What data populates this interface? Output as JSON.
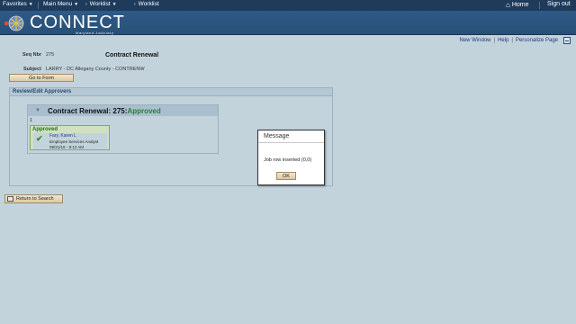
{
  "topbar": {
    "favorites": "Favorites",
    "main_menu": "Main Menu",
    "breadcrumb_1": "Worklist",
    "breadcrumb_2": "Worklist",
    "home": "Home",
    "sign_out": "Sign out"
  },
  "brand": {
    "name": "CONNECT",
    "subtitle": "Maryland Judiciary"
  },
  "links": {
    "new_window": "New Window",
    "help": "Help",
    "personalize": "Personalize Page"
  },
  "form": {
    "seq_label": "Seq Nbr",
    "seq_value": "275",
    "title": "Contract Renewal",
    "subject_label": "Subject",
    "subject_value": "LARRY - DC Allegany County - CONTRENW",
    "go_to_form": "Go to Form"
  },
  "section": {
    "header": "Review/Edit Approvers"
  },
  "workflow": {
    "title": "Contract Renewal: 275:",
    "status": "Approved",
    "step_number": "1",
    "approver_status": "Approved",
    "approver_name": "Fary, Karen L",
    "approver_role": "Employee Services Analyst",
    "approver_date": "09/21/16 - 9:12 AM"
  },
  "dialog": {
    "title": "Message",
    "message": "Job row inserted (0,0)",
    "ok": "OK"
  },
  "footer": {
    "return_to_search": "Return to Search"
  },
  "icons": [
    "caret-down-icon",
    "home-icon",
    "connect-logo-icon",
    "grid-icon",
    "triangle-down-icon",
    "checkmark-icon",
    "return-icon"
  ],
  "colors": {
    "topbar": "#1f3b5c",
    "banner": "#2f5a86",
    "background": "#c3d3dc",
    "approved_green": "#2e7d32"
  }
}
